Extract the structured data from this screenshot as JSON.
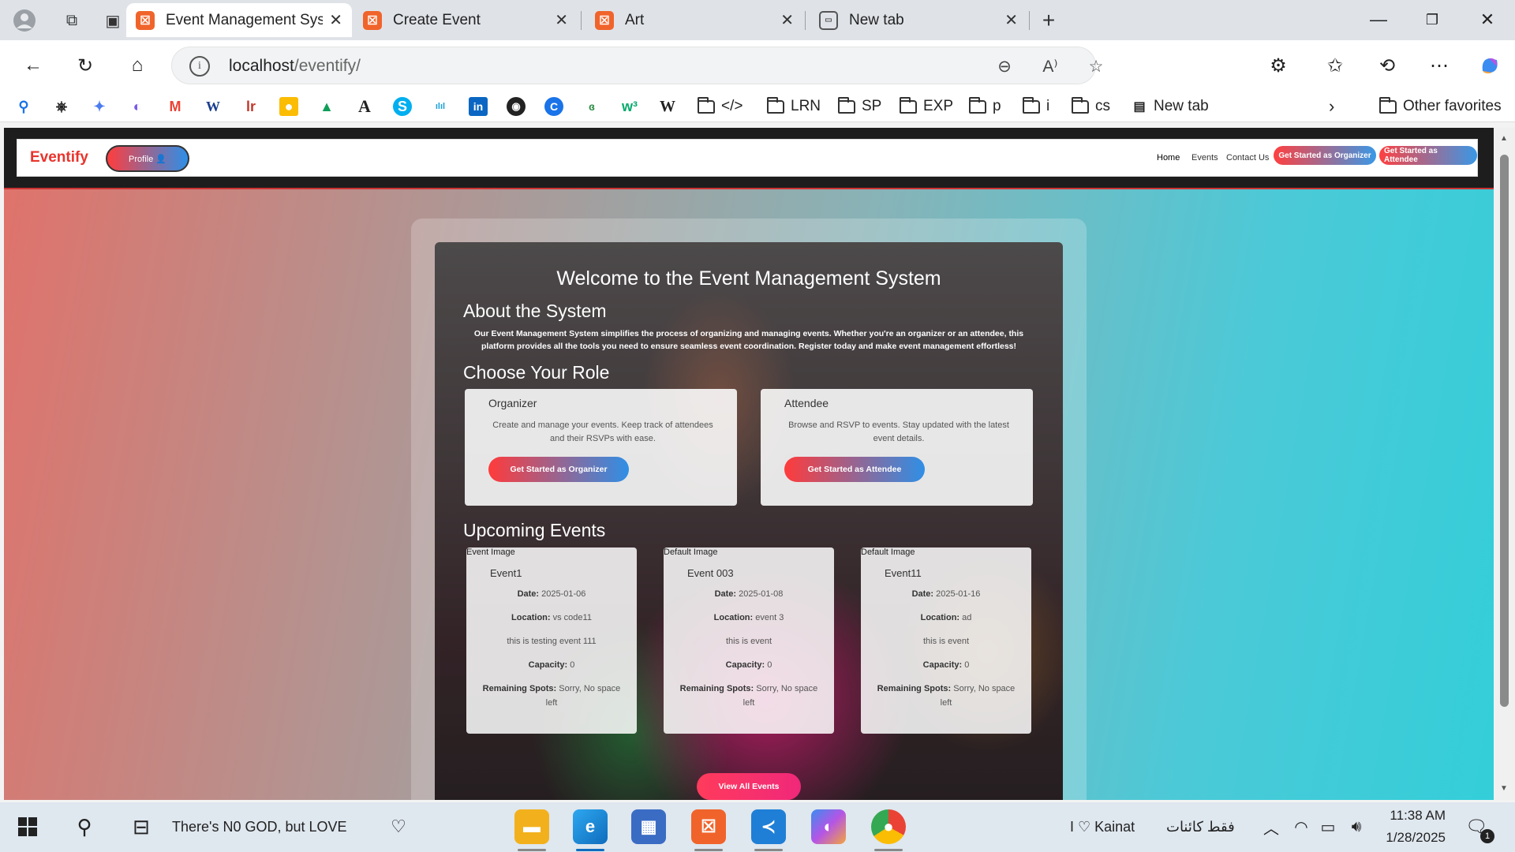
{
  "browser": {
    "tabs": [
      {
        "label": "Event Management System",
        "active": true,
        "favicon": "xampp-icon"
      },
      {
        "label": "Create Event",
        "active": false,
        "favicon": "xampp-icon"
      },
      {
        "label": "Art",
        "active": false,
        "favicon": "xampp-icon"
      },
      {
        "label": "New tab",
        "active": false,
        "favicon": "new-tab-icon"
      }
    ],
    "address": {
      "host": "localhost",
      "path": "/eventify/"
    },
    "bookmarks": [
      {
        "label": "",
        "icon": "search-icon"
      },
      {
        "label": "",
        "icon": "openai-icon"
      },
      {
        "label": "",
        "icon": "gemini-icon"
      },
      {
        "label": "",
        "icon": "copilot-icon"
      },
      {
        "label": "",
        "icon": "gmail-icon"
      },
      {
        "label": "",
        "icon": "w3-icon"
      },
      {
        "label": "",
        "icon": "lms-icon"
      },
      {
        "label": "",
        "icon": "keep-icon"
      },
      {
        "label": "",
        "icon": "drive-icon"
      },
      {
        "label": "",
        "icon": "font-icon"
      },
      {
        "label": "",
        "icon": "skype-icon"
      },
      {
        "label": "",
        "icon": "cisco-icon"
      },
      {
        "label": "",
        "icon": "linkedin-icon"
      },
      {
        "label": "",
        "icon": "github-icon"
      },
      {
        "label": "",
        "icon": "c-icon"
      },
      {
        "label": "",
        "icon": "geeks-icon"
      },
      {
        "label": "",
        "icon": "w3schools-icon"
      },
      {
        "label": "",
        "icon": "wikipedia-icon"
      }
    ],
    "folders": [
      "</>",
      "LRN",
      "SP",
      "EXP",
      "p",
      "i",
      "cs"
    ],
    "new_tab_bookmark": "New tab",
    "other_favorites": "Other favorites",
    "accent_color": "#f0642b"
  },
  "site": {
    "brand": "Eventify",
    "profile_button": "Profile 👤",
    "nav": {
      "home": "Home",
      "events": "Events",
      "contact": "Contact Us"
    },
    "cta_organizer": "Get Started as Organizer",
    "cta_attendee": "Get Started as Attendee",
    "brand_color": "#e8342c"
  },
  "hero": {
    "title": "Welcome to the Event Management System",
    "about_heading": "About the System",
    "about_text": "Our Event Management System simplifies the process of organizing and managing events. Whether you're an organizer or an attendee, this platform provides all the tools you need to ensure seamless event coordination. Register today and make event management effortless!",
    "role_heading": "Choose Your Role",
    "roles": [
      {
        "title": "Organizer",
        "desc": "Create and manage your events. Keep track of attendees and their RSVPs with ease.",
        "button": "Get Started as Organizer"
      },
      {
        "title": "Attendee",
        "desc": "Browse and RSVP to events. Stay updated with the latest event details.",
        "button": "Get Started as Attendee"
      }
    ],
    "events_heading": "Upcoming Events",
    "events": [
      {
        "img_alt": "Event Image",
        "title": "Event1",
        "date": "2025-01-06",
        "location": "vs code11",
        "desc": "this is testing event 111",
        "capacity": "0",
        "remaining": "Sorry, No space left"
      },
      {
        "img_alt": "Default Image",
        "title": "Event 003",
        "date": "2025-01-08",
        "location": "event 3",
        "desc": "this is event",
        "capacity": "0",
        "remaining": "Sorry, No space left"
      },
      {
        "img_alt": "Default Image",
        "title": "Event11",
        "date": "2025-01-16",
        "location": "ad",
        "desc": "this is event",
        "capacity": "0",
        "remaining": "Sorry, No space left"
      }
    ],
    "labels": {
      "date": "Date:",
      "location": "Location:",
      "capacity": "Capacity:",
      "remaining": "Remaining Spots:"
    },
    "view_all": "View All Events"
  },
  "taskbar": {
    "search_text": "There's N0 GOD, but LOVE",
    "user_text": "I ♡ Kainat",
    "arabic_text": "فقط کائنات",
    "time": "11:38 AM",
    "date": "1/28/2025",
    "notification_count": "1"
  }
}
